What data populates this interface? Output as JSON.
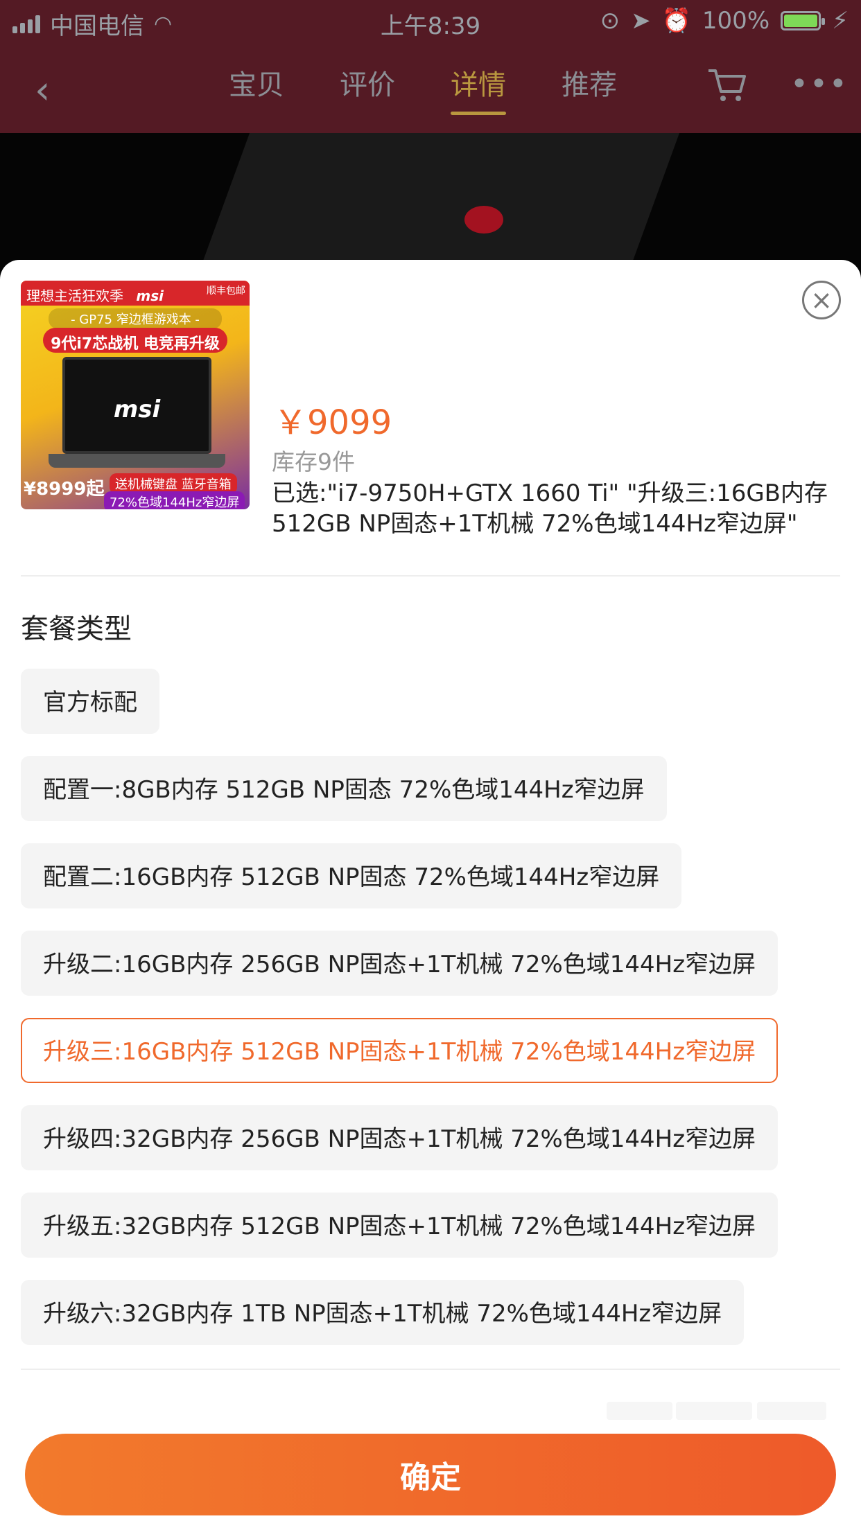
{
  "status_bar": {
    "carrier": "中国电信",
    "time": "上午8:39",
    "battery": "100%",
    "battery_level": 1.0,
    "wifi_icon": "wifi-icon",
    "colors": {
      "battery": "#7ed957"
    }
  },
  "nav": {
    "tabs": [
      {
        "label": "宝贝"
      },
      {
        "label": "评价"
      },
      {
        "label": "详情",
        "active": true
      },
      {
        "label": "推荐"
      }
    ],
    "more_icon": "more-icon",
    "cart_icon": "cart-icon",
    "back_icon": "back-chevron-icon",
    "colors": {
      "active_tab": "#b9973f",
      "background": "#541a24"
    }
  },
  "product": {
    "thumb_texts": {
      "banner": "理想主活狂欢季",
      "brand": "msi",
      "tag": "顺丰包邮",
      "title": "- GP75 窄边框游戏本 -",
      "subtitle": "9代i7芯战机 电竞再升级",
      "price": "¥8999起",
      "features": "送机械键盘 蓝牙音箱",
      "screen": "72%色域144Hz窄边屏"
    },
    "price": "￥9099",
    "stock": "库存9件",
    "selected": "已选:\"i7-9750H+GTX 1660 Ti\" \"升级三:16GB内存 512GB NP固态+1T机械 72%色域144Hz窄边屏\""
  },
  "package": {
    "title": "套餐类型",
    "options": [
      {
        "label": "官方标配"
      },
      {
        "label": "配置一:8GB内存 512GB NP固态 72%色域144Hz窄边屏"
      },
      {
        "label": "配置二:16GB内存 512GB NP固态 72%色域144Hz窄边屏"
      },
      {
        "label": "升级二:16GB内存 256GB NP固态+1T机械 72%色域144Hz窄边屏"
      },
      {
        "label": "升级三:16GB内存 512GB NP固态+1T机械 72%色域144Hz窄边屏",
        "selected": true
      },
      {
        "label": "升级四:32GB内存 256GB NP固态+1T机械 72%色域144Hz窄边屏"
      },
      {
        "label": "升级五:32GB内存 512GB NP固态+1T机械 72%色域144Hz窄边屏"
      },
      {
        "label": "升级六:32GB内存 1TB NP固态+1T机械 72%色域144Hz窄边屏"
      }
    ]
  },
  "confirm_label": "确定",
  "colors": {
    "accent": "#f0692c"
  }
}
